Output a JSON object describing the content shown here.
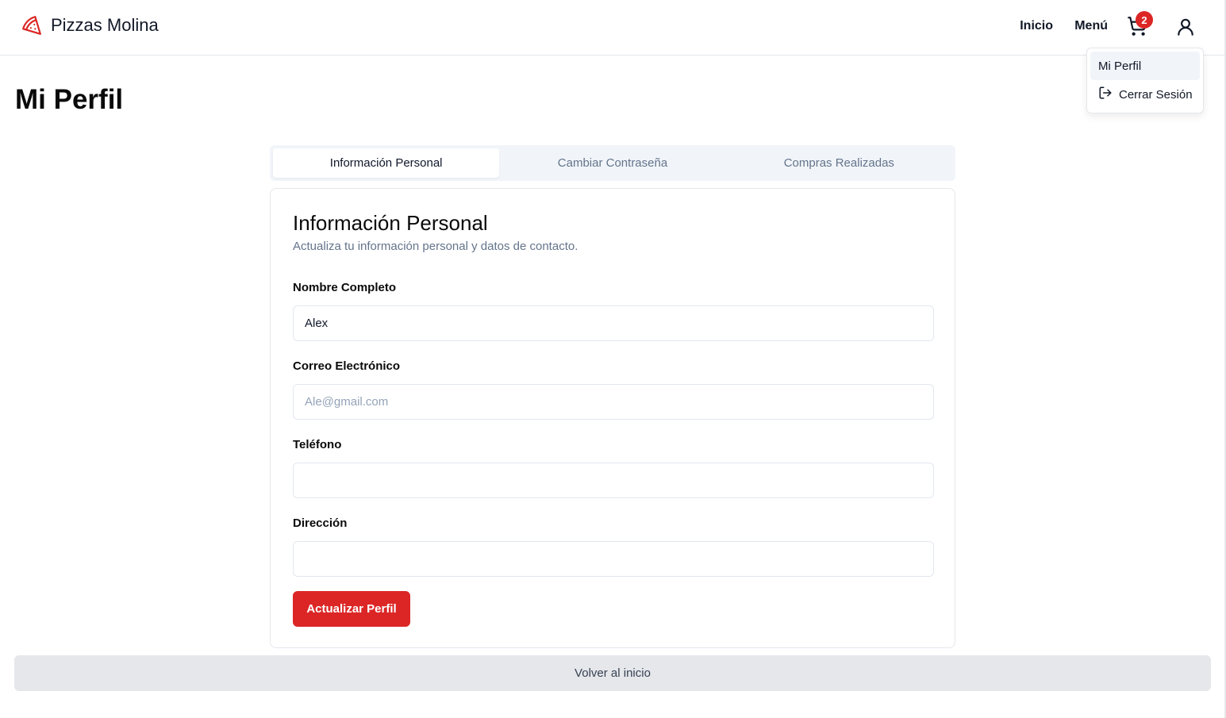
{
  "header": {
    "brand_name": "Pizzas Molina",
    "nav": {
      "inicio": "Inicio",
      "menu": "Menú"
    },
    "cart_count": "2",
    "brand_color": "#dc2626"
  },
  "dropdown": {
    "items": [
      {
        "label": "Mi Perfil",
        "active": true
      },
      {
        "label": "Cerrar Sesión",
        "icon": "logout-icon"
      }
    ]
  },
  "page": {
    "title": "Mi Perfil"
  },
  "tabs": [
    {
      "label": "Información Personal",
      "active": true
    },
    {
      "label": "Cambiar Contraseña"
    },
    {
      "label": "Compras Realizadas"
    }
  ],
  "card": {
    "title": "Información Personal",
    "description": "Actualiza tu información personal y datos de contacto.",
    "fields": {
      "name": {
        "label": "Nombre Completo",
        "value": "Alex"
      },
      "email": {
        "label": "Correo Electrónico",
        "value": "Ale@gmail.com"
      },
      "phone": {
        "label": "Teléfono",
        "value": ""
      },
      "address": {
        "label": "Dirección",
        "value": ""
      }
    },
    "submit_label": "Actualizar Perfil"
  },
  "back_label": "Volver al inicio"
}
